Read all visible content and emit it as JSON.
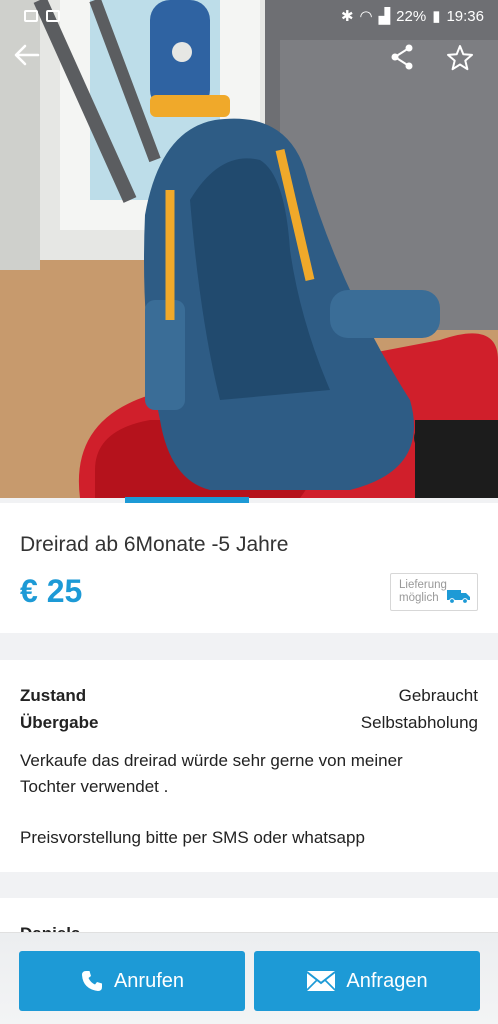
{
  "status_bar": {
    "battery": "22%",
    "time": "19:36"
  },
  "listing": {
    "title": "Dreirad ab 6Monate -5 Jahre",
    "price": "€ 25",
    "delivery_badge": {
      "line1": "Lieferung",
      "line2": "möglich"
    }
  },
  "details": {
    "rows": [
      {
        "label": "Zustand",
        "value": "Gebraucht"
      },
      {
        "label": "Übergabe",
        "value": "Selbstabholung"
      }
    ],
    "description_line1": "Verkaufe das dreirad würde sehr gerne von meiner",
    "description_line2": "Tochter verwendet .",
    "description_line3": "Preisvorstellung bitte per SMS oder whatsapp"
  },
  "seller": {
    "name": "Daniela"
  },
  "actions": {
    "call_label": "Anrufen",
    "request_label": "Anfragen"
  },
  "colors": {
    "accent": "#1d9ad6"
  },
  "icons": [
    "back-arrow-icon",
    "share-icon",
    "star-icon",
    "truck-icon",
    "phone-icon",
    "envelope-icon"
  ]
}
